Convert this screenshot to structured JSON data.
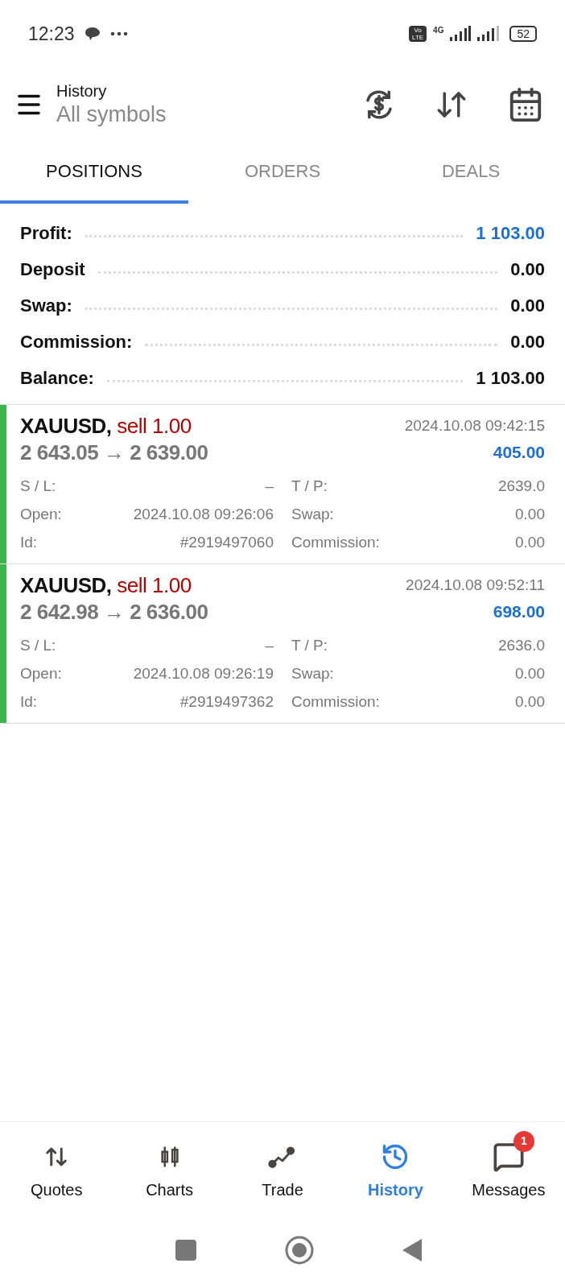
{
  "status_bar": {
    "time": "12:23",
    "network": "4G",
    "volte": "Vo LTE",
    "battery": "52"
  },
  "header": {
    "title": "History",
    "subtitle": "All symbols"
  },
  "tabs": [
    {
      "label": "POSITIONS",
      "selected": true
    },
    {
      "label": "ORDERS",
      "selected": false
    },
    {
      "label": "DEALS",
      "selected": false
    }
  ],
  "summary": [
    {
      "label": "Profit:",
      "value": "1 103.00",
      "highlight": true
    },
    {
      "label": "Deposit",
      "value": "0.00",
      "highlight": false
    },
    {
      "label": "Swap:",
      "value": "0.00",
      "highlight": false
    },
    {
      "label": "Commission:",
      "value": "0.00",
      "highlight": false
    },
    {
      "label": "Balance:",
      "value": "1 103.00",
      "highlight": false
    }
  ],
  "positions": [
    {
      "symbol": "XAUUSD,",
      "side": "sell 1.00",
      "prices": "2 643.05 → 2 639.00",
      "time": "2024.10.08 09:42:15",
      "profit": "405.00",
      "fields": [
        {
          "label": "S / L:",
          "value": "–"
        },
        {
          "label": "T / P:",
          "value": "2639.0"
        },
        {
          "label": "Open:",
          "value": "2024.10.08 09:26:06"
        },
        {
          "label": "Swap:",
          "value": "0.00"
        },
        {
          "label": "Id:",
          "value": "#2919497060"
        },
        {
          "label": "Commission:",
          "value": "0.00"
        }
      ]
    },
    {
      "symbol": "XAUUSD,",
      "side": "sell 1.00",
      "prices": "2 642.98 → 2 636.00",
      "time": "2024.10.08 09:52:11",
      "profit": "698.00",
      "fields": [
        {
          "label": "S / L:",
          "value": "–"
        },
        {
          "label": "T / P:",
          "value": "2636.0"
        },
        {
          "label": "Open:",
          "value": "2024.10.08 09:26:19"
        },
        {
          "label": "Swap:",
          "value": "0.00"
        },
        {
          "label": "Id:",
          "value": "#2919497362"
        },
        {
          "label": "Commission:",
          "value": "0.00"
        }
      ]
    }
  ],
  "nav": [
    {
      "label": "Quotes",
      "selected": false
    },
    {
      "label": "Charts",
      "selected": false
    },
    {
      "label": "Trade",
      "selected": false
    },
    {
      "label": "History",
      "selected": true
    },
    {
      "label": "Messages",
      "selected": false,
      "badge": "1"
    }
  ]
}
